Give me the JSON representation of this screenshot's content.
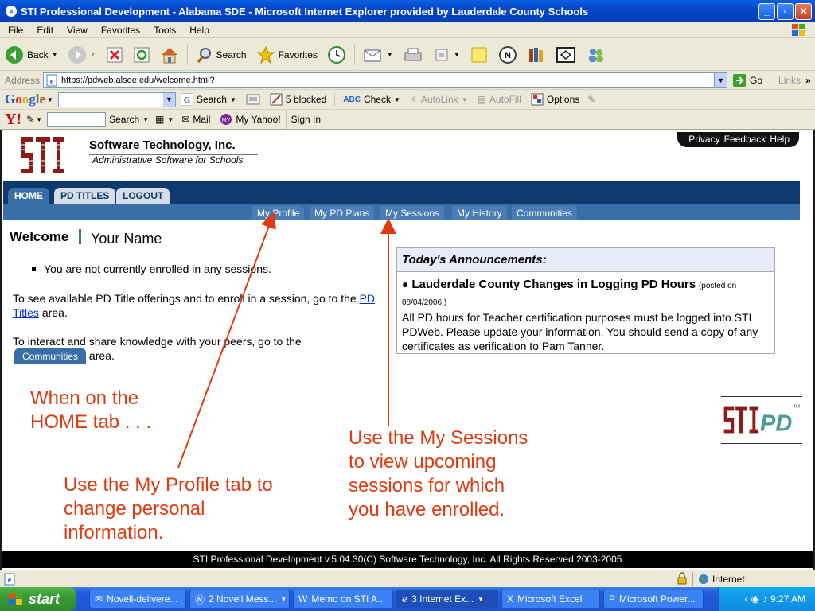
{
  "window": {
    "title": "STI Professional Development - Alabama SDE - Microsoft Internet Explorer provided by Lauderdale County Schools",
    "buttons": {
      "minimize": "_",
      "maximize": "▫",
      "close": "✕"
    }
  },
  "menu": [
    "File",
    "Edit",
    "View",
    "Favorites",
    "Tools",
    "Help"
  ],
  "toolbar": {
    "back_label": "Back",
    "search_label": "Search",
    "favorites_label": "Favorites"
  },
  "address": {
    "label": "Address",
    "url": "https://pdweb.alsde.edu/welcome.html?",
    "go_label": "Go",
    "links_label": "Links"
  },
  "google_bar": {
    "logo": "Google",
    "search_label": "Search",
    "blocked_label": "5 blocked",
    "check_label": "Check",
    "autolink_label": "AutoLink",
    "autofill_label": "AutoFill",
    "options_label": "Options"
  },
  "yahoo_bar": {
    "logo": "Y!",
    "search_label": "Search",
    "mail_label": "Mail",
    "my_yahoo_label": "My Yahoo!",
    "sign_in_label": "Sign In"
  },
  "page": {
    "logo_text": "STI",
    "company_name": "Software Technology, Inc.",
    "company_tagline": "Administrative Software for Schools",
    "top_links": [
      "Privacy",
      "Feedback",
      "Help"
    ],
    "tabs": [
      {
        "label": "HOME",
        "active": true
      },
      {
        "label": "PD TITLES",
        "active": false
      },
      {
        "label": "LOGOUT",
        "active": false
      }
    ],
    "subtabs": [
      "My Profile",
      "My PD Plans",
      "My Sessions",
      "My History",
      "Communities"
    ],
    "welcome_label": "Welcome",
    "user_name": "Your Name",
    "not_enrolled": "You are not currently enrolled in any sessions.",
    "pd_titles_text_before": "To see available PD Title offerings and to enroll in a session, go to the",
    "pd_titles_link": "PD Titles",
    "pd_titles_text_after": "area.",
    "communities_text_before": "To interact and share knowledge with your peers, go to the",
    "communities_button": "Communities",
    "communities_text_after": "area.",
    "announcements": {
      "header": "Today's Announcements:",
      "title": "Lauderdale County Changes in Logging PD Hours",
      "posted": "(posted on 08/04/2006 )",
      "body": "All PD hours for Teacher certification purposes must be logged into STI PDWeb. Please update your information. You should send a copy of any certificates as verification to Pam Tanner."
    },
    "footer": "STI Professional Development v.5.04.30(C) Software Technology, Inc. All Rights Reserved 2003-2005"
  },
  "annotations": {
    "home_tab": "When on the HOME tab . . .",
    "my_profile": "Use the My Profile tab to change personal information.",
    "my_sessions": "Use the My Sessions to view upcoming sessions for which you have enrolled."
  },
  "status": {
    "zone": "Internet"
  },
  "taskbar": {
    "start_label": "start",
    "tasks": [
      {
        "label": "Novell-delivere...",
        "active": false
      },
      {
        "label": "2 Novell Mess...",
        "active": false
      },
      {
        "label": "Memo on STI A...",
        "active": false
      },
      {
        "label": "3 Internet Ex...",
        "active": true
      },
      {
        "label": "Microsoft Excel",
        "active": false
      },
      {
        "label": "Microsoft Power...",
        "active": false
      }
    ],
    "clock": "9:27 AM"
  },
  "colors": {
    "nav_dark": "#0e3a6e",
    "nav_light": "#3a6ea8",
    "annotation": "#e03a10",
    "logo_red": "#8b1a1a"
  }
}
